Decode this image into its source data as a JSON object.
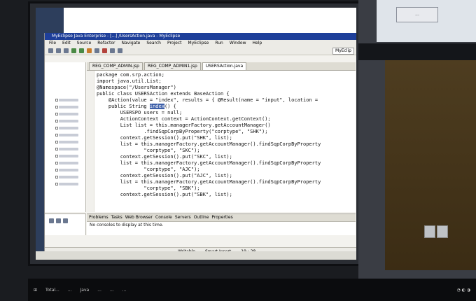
{
  "window_title": "MyEclipse Java Enterprise - [...] /UsersAction.java - MyEclipse",
  "menu": [
    "File",
    "Edit",
    "Source",
    "Refactor",
    "Navigate",
    "Search",
    "Project",
    "MyEclipse",
    "Run",
    "Window",
    "Help"
  ],
  "perspective": "MyEclip",
  "editor_tabs": [
    {
      "label": "REG_COMP_ADMIN.jsp",
      "active": false
    },
    {
      "label": "REG_COMP_ADMIN1.jsp",
      "active": false
    },
    {
      "label": "USERSAction.java",
      "active": true
    }
  ],
  "code": [
    "package com.srp.action;",
    "import java.util.List;",
    "@Namespace(\"/UsersManager\")",
    "public class USERSAction extends BaseAction {",
    "    @Action(value = \"index\", results = { @Result(name = \"input\", location =",
    "    public String index() {",
    "        USERSPO users = null;",
    "        ActionContext context = ActionContext.getContext();",
    "        List list = this.managerFactory.getAccountManager()",
    "                .findSqpCorpByProperty(\"corptype\", \"SHK\");",
    "        context.getSession().put(\"SHK\", list);",
    "        list = this.managerFactory.getAccountManager().findSqpCorpByProperty",
    "                \"corptype\", \"SKC\");",
    "        context.getSession().put(\"SKC\", list);",
    "        list = this.managerFactory.getAccountManager().findSqpCorpByProperty",
    "                \"corptype\", \"AJC\");",
    "        context.getSession().put(\"AJC\", list);",
    "        list = this.managerFactory.getAccountManager().findSqpCorpByProperty",
    "                \"corptype\", \"SBK\");",
    "        context.getSession().put(\"SBK\", list);"
  ],
  "selected_word": "index",
  "views_tabs": [
    "Problems",
    "Tasks",
    "Web Browser",
    "Console",
    "Servers",
    "Outline",
    "Properties"
  ],
  "console_message": "No consoles to display at this time.",
  "status": {
    "writable": "Writable",
    "insert": "Smart Insert",
    "position": "19 : 28"
  },
  "right_monitor": {
    "button_label": "..."
  },
  "taskbar": [
    "Total...",
    "...",
    "Java",
    "...",
    "...",
    "..."
  ]
}
